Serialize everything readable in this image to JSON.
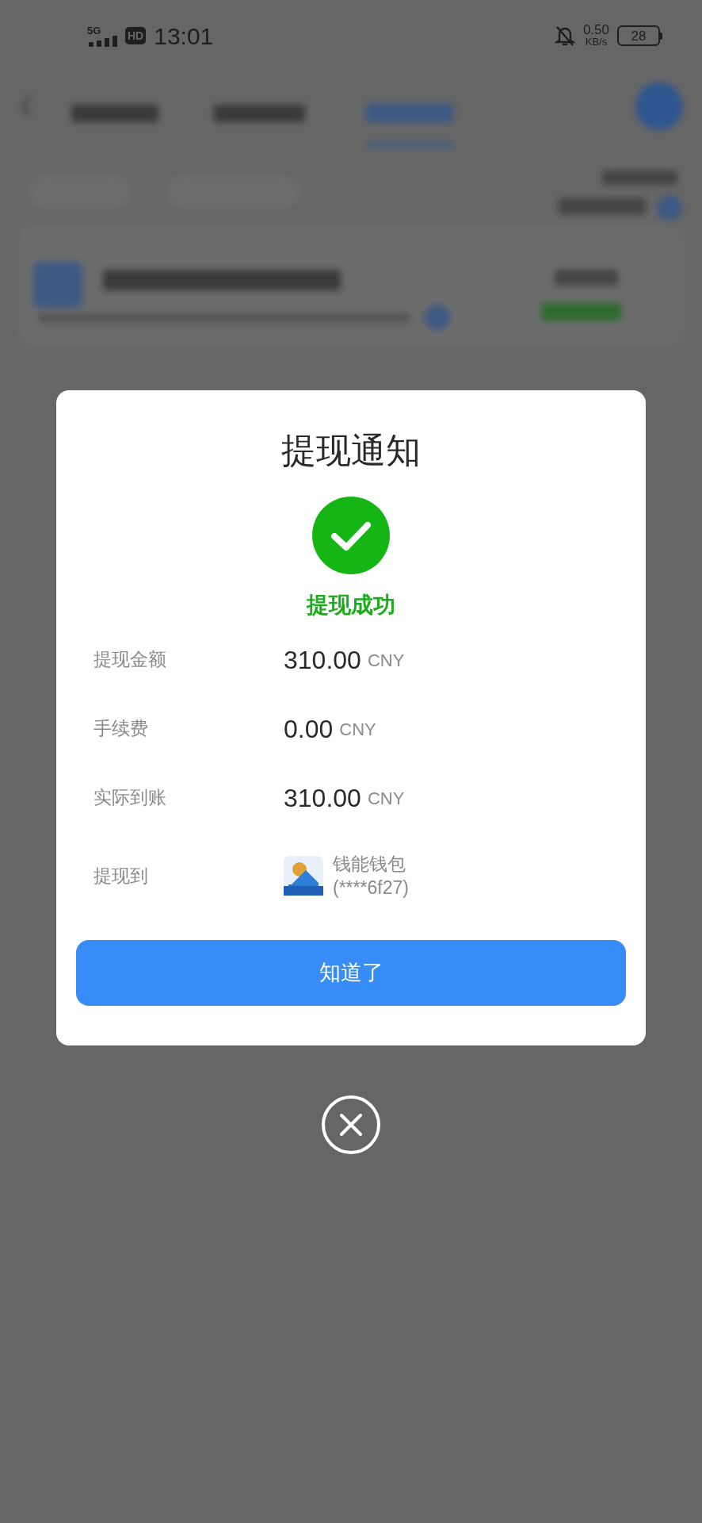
{
  "status_bar": {
    "network": "5G",
    "hd_badge": "HD",
    "time": "13:01",
    "speed_value": "0.50",
    "speed_unit": "KB/s",
    "battery": "28"
  },
  "dialog": {
    "title": "提现通知",
    "status": "提现成功",
    "rows": [
      {
        "kind": "amount",
        "label": "提现金额",
        "value": "310.00",
        "unit": "CNY"
      },
      {
        "kind": "amount",
        "label": "手续费",
        "value": "0.00",
        "unit": "CNY"
      },
      {
        "kind": "amount",
        "label": "实际到账",
        "value": "310.00",
        "unit": "CNY"
      },
      {
        "kind": "wallet",
        "label": "提现到",
        "name": "钱能钱包",
        "account": "(****6f27)"
      }
    ],
    "confirm_button": "知道了"
  }
}
